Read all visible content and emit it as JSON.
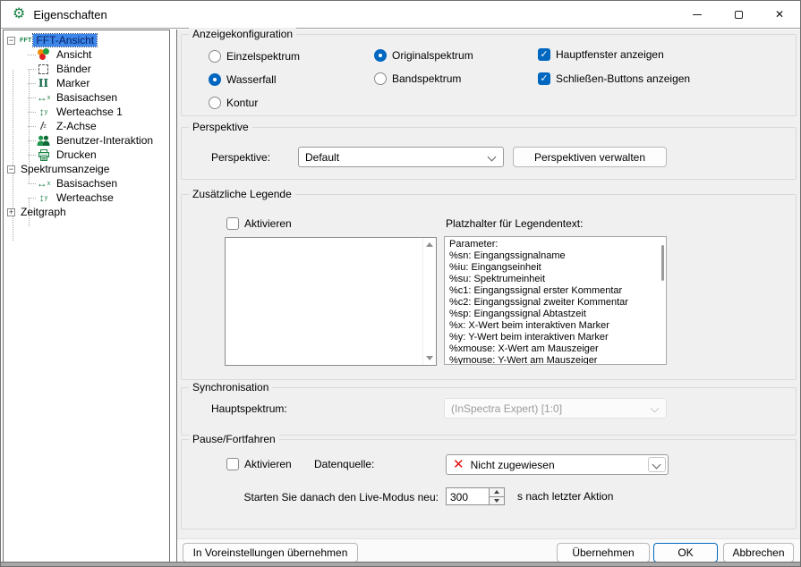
{
  "window": {
    "title": "Eigenschaften"
  },
  "icons": {
    "gear": "⚙",
    "close": "✕",
    "check": "✓",
    "collapse": "−",
    "expand": "+",
    "fft": "FFT",
    "marker": "II",
    "h_arrow": "↔",
    "v_arrow": "↕",
    "diag": "/",
    "error_x": "✕"
  },
  "tree": {
    "items": [
      {
        "label": "FFT-Ansicht",
        "selected": true
      },
      {
        "label": "Ansicht"
      },
      {
        "label": "Bänder"
      },
      {
        "label": "Marker"
      },
      {
        "label": "Basisachsen"
      },
      {
        "label": "Werteachse 1"
      },
      {
        "label": "Z-Achse"
      },
      {
        "label": "Benutzer-Interaktion"
      },
      {
        "label": "Drucken"
      },
      {
        "label": "Spektrumsanzeige"
      },
      {
        "label": "Basisachsen"
      },
      {
        "label": "Werteachse"
      },
      {
        "label": "Zeitgraph"
      }
    ]
  },
  "display_config": {
    "title": "Anzeigekonfiguration",
    "radios_style": [
      {
        "label": "Einzelspektrum",
        "checked": false
      },
      {
        "label": "Wasserfall",
        "checked": true
      },
      {
        "label": "Kontur",
        "checked": false
      }
    ],
    "radios_spectrum": [
      {
        "label": "Originalspektrum",
        "checked": true
      },
      {
        "label": "Bandspektrum",
        "checked": false
      }
    ],
    "checkboxes": [
      {
        "label": "Hauptfenster anzeigen",
        "checked": true
      },
      {
        "label": "Schließen-Buttons anzeigen",
        "checked": true
      }
    ]
  },
  "perspective": {
    "title": "Perspektive",
    "label": "Perspektive:",
    "selected": "Default",
    "manage_button": "Perspektiven verwalten"
  },
  "legend": {
    "title": "Zusätzliche Legende",
    "activate_label": "Aktivieren",
    "activate_checked": false,
    "text_value": "",
    "placeholder_title": "Platzhalter für Legendentext:",
    "placeholders": [
      "Parameter:",
      "%sn: Eingangssignalname",
      "%iu: Eingangseinheit",
      "%su: Spektrumeinheit",
      "%c1: Eingangssignal erster Kommentar",
      "%c2: Eingangssignal zweiter Kommentar",
      "%sp: Eingangssignal Abtastzeit",
      "%x: X-Wert beim interaktiven Marker",
      "%y: Y-Wert beim interaktiven Marker",
      "%xmouse: X-Wert am Mauszeiger",
      "%ymouse: Y-Wert am Mauszeiger"
    ]
  },
  "synchronisation": {
    "title": "Synchronisation",
    "label": "Hauptspektrum:",
    "selected": "(InSpectra Expert) [1:0]",
    "enabled": false
  },
  "pause_resume": {
    "title": "Pause/Fortfahren",
    "activate_label": "Aktivieren",
    "activate_checked": false,
    "datasource_label": "Datenquelle:",
    "datasource_value": "Nicht zugewiesen",
    "restart_label": "Starten Sie danach den Live-Modus neu:",
    "restart_value": "300",
    "restart_suffix": "s nach letzter Aktion"
  },
  "footer": {
    "apply_presets": "In Voreinstellungen übernehmen",
    "apply": "Übernehmen",
    "ok": "OK",
    "cancel": "Abbrechen"
  },
  "colors": {
    "accent": "#0067c0",
    "selection_bg": "#3c87e8",
    "error_red": "#e01212",
    "icon_green": "#1d8348"
  }
}
